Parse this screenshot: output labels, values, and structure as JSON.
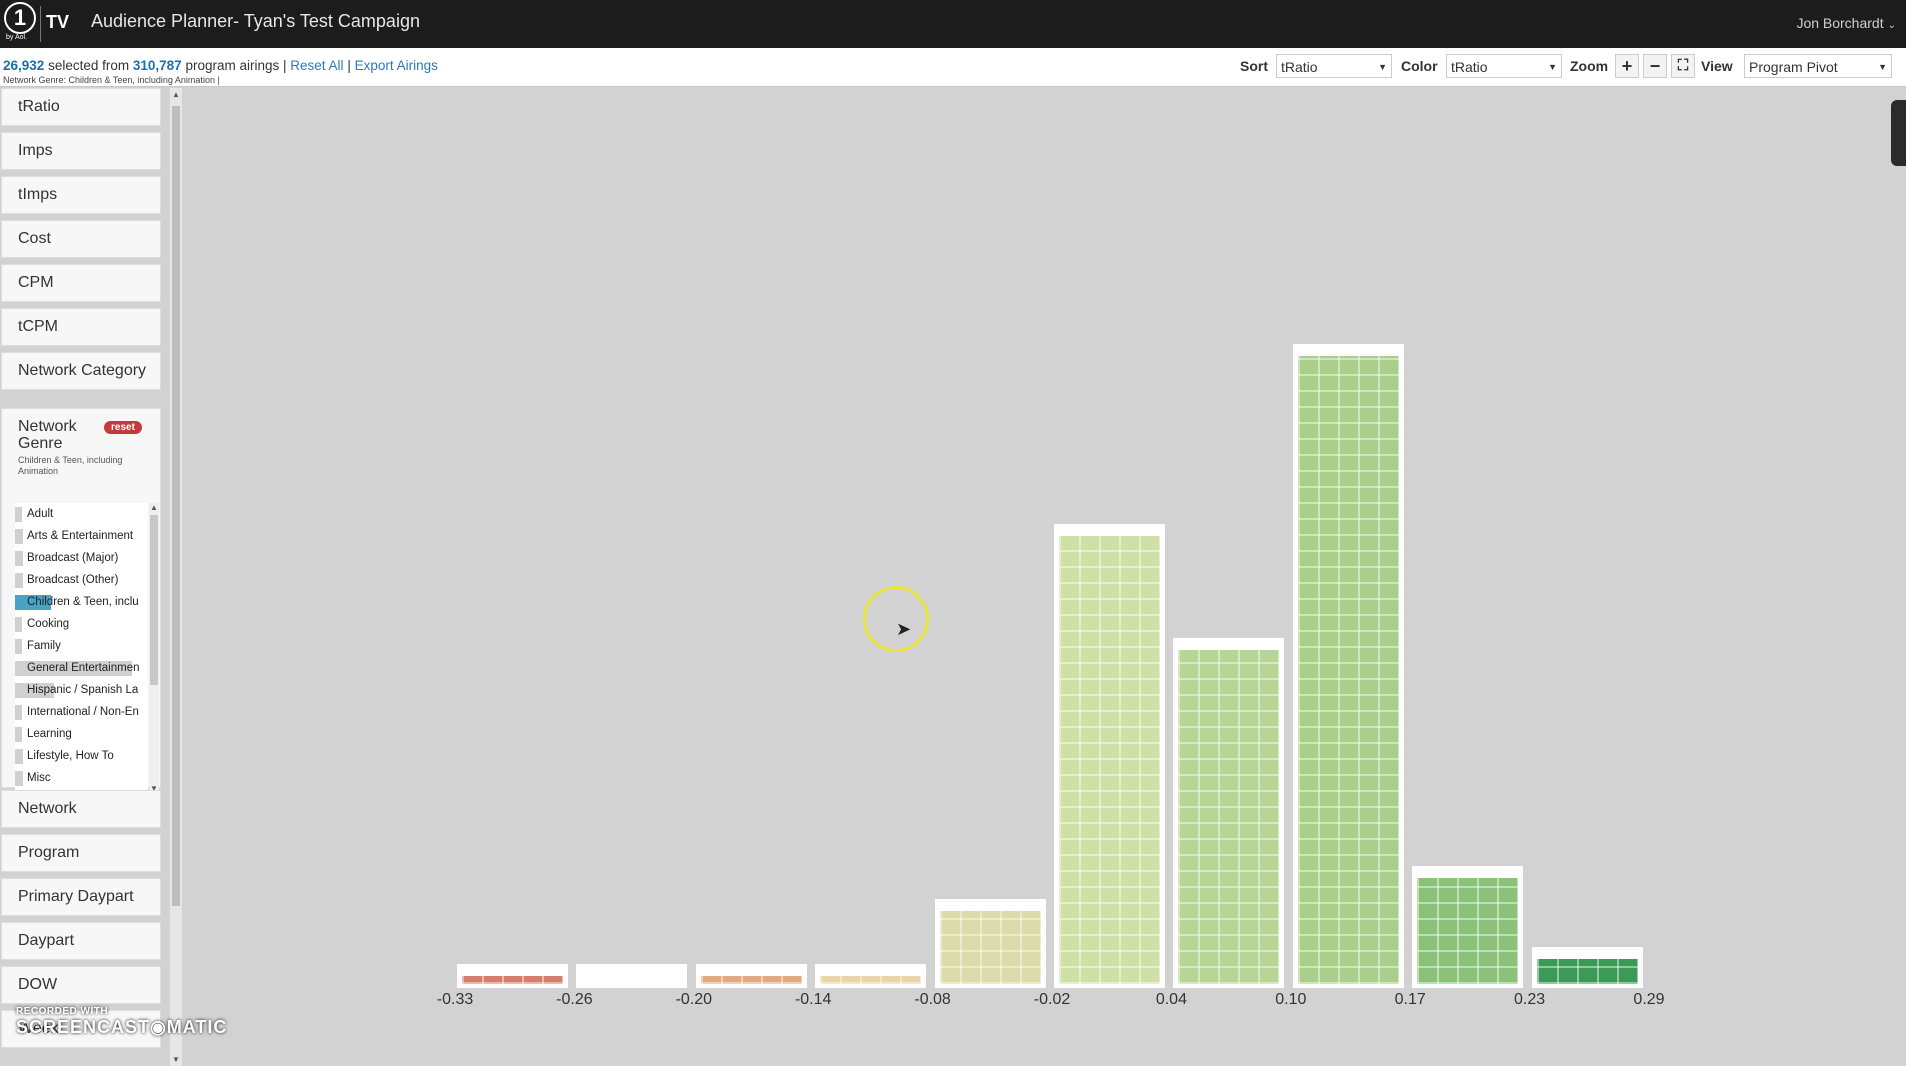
{
  "header": {
    "logo_text": "1",
    "logo_sub": "by Aol.",
    "logo_tv": "TV",
    "app_title": "Audience Planner- Tyan's Test Campaign",
    "user_name": "Jon Borchardt"
  },
  "status": {
    "selected_count": "26,932",
    "selected_text": "selected from",
    "total_count": "310,787",
    "total_text": "program airings |",
    "reset_all": "Reset All",
    "sep": "|",
    "export": "Export Airings",
    "filter_note": "Network Genre: Children & Teen, including Animation |"
  },
  "controls": {
    "sort_label": "Sort",
    "sort_value": "tRatio",
    "color_label": "Color",
    "color_value": "tRatio",
    "zoom_label": "Zoom",
    "zoom_in": "+",
    "zoom_out": "−",
    "fullscreen": "⛶",
    "view_label": "View",
    "view_value": "Program Pivot"
  },
  "sidebar": {
    "items_top": [
      "tRatio",
      "Imps",
      "tImps",
      "Cost",
      "CPM",
      "tCPM",
      "Network Category"
    ],
    "genre": {
      "title": "Network Genre",
      "reset": "reset",
      "note": "Children & Teen, including Animation",
      "items": [
        {
          "label": "Adult",
          "share": 0.05,
          "selected": false
        },
        {
          "label": "Arts & Entertainment",
          "share": 0.06,
          "selected": false
        },
        {
          "label": "Broadcast (Major)",
          "share": 0.06,
          "selected": false
        },
        {
          "label": "Broadcast (Other)",
          "share": 0.06,
          "selected": false
        },
        {
          "label": "Children & Teen, inclu",
          "share": 0.28,
          "selected": true
        },
        {
          "label": "Cooking",
          "share": 0.05,
          "selected": false
        },
        {
          "label": "Family",
          "share": 0.05,
          "selected": false
        },
        {
          "label": "General Entertainmen",
          "share": 0.9,
          "selected": false
        },
        {
          "label": "Hispanic / Spanish La",
          "share": 0.3,
          "selected": false
        },
        {
          "label": "International / Non-En",
          "share": 0.05,
          "selected": false
        },
        {
          "label": "Learning",
          "share": 0.05,
          "selected": false
        },
        {
          "label": "Lifestyle, How To",
          "share": 0.06,
          "selected": false
        },
        {
          "label": "Misc",
          "share": 0.06,
          "selected": false
        }
      ]
    },
    "items_bottom": [
      "Network",
      "Program",
      "Primary Daypart",
      "Daypart",
      "DOW",
      "Week"
    ]
  },
  "chart_data": {
    "type": "bar",
    "xlabel": "",
    "ylabel": "",
    "ticks": [
      "-0.33",
      "-0.26",
      "-0.20",
      "-0.14",
      "-0.08",
      "-0.02",
      "0.04",
      "0.10",
      "0.17",
      "0.23",
      "0.29"
    ],
    "series": [
      {
        "values": [
          1,
          0,
          1,
          1,
          5,
          28,
          21,
          39,
          7,
          2
        ],
        "colors": [
          "#d47f6e",
          "#ffffff",
          "#dfa982",
          "#e8d6a8",
          "#dcdbab",
          "#cfe0a6",
          "#b7d595",
          "#a9cf8a",
          "#8cc179",
          "#3c9a57"
        ]
      }
    ],
    "grid": false,
    "legend": "none"
  },
  "watermark": {
    "top": "RECORDED WITH",
    "main": "SCREENCAST◉MATIC"
  }
}
